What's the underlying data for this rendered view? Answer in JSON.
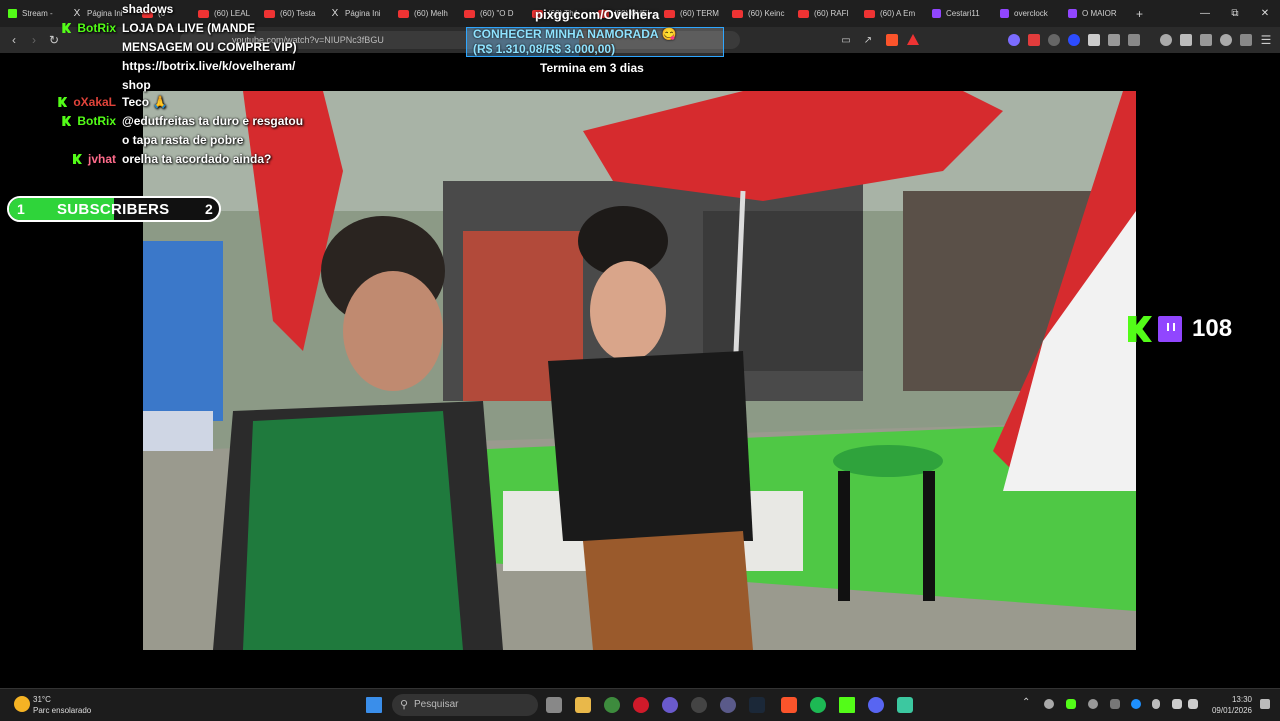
{
  "browser": {
    "tabs": [
      {
        "label": "Stream -",
        "icon": "kick-icon",
        "kind": "k"
      },
      {
        "label": "Página Ini",
        "icon": "x-icon",
        "kind": "x"
      },
      {
        "label": "(6",
        "icon": "youtube-icon",
        "kind": "yt"
      },
      {
        "label": "(60) LEAL",
        "icon": "youtube-icon",
        "kind": "yt"
      },
      {
        "label": "(60) Testa",
        "icon": "youtube-icon",
        "kind": "yt"
      },
      {
        "label": "Página Ini",
        "icon": "x-icon",
        "kind": "x"
      },
      {
        "label": "(60) Melh",
        "icon": "youtube-icon",
        "kind": "yt"
      },
      {
        "label": "(60) \"O D",
        "icon": "youtube-icon",
        "kind": "yt"
      },
      {
        "label": "(60) Thé",
        "icon": "youtube-icon",
        "kind": "yt"
      },
      {
        "label": "(60) CHEI",
        "icon": "youtube-icon",
        "kind": "yt"
      },
      {
        "label": "(60) TERM",
        "icon": "youtube-icon",
        "kind": "yt"
      },
      {
        "label": "(60) Keinc",
        "icon": "youtube-icon",
        "kind": "yt"
      },
      {
        "label": "(60) RAFI",
        "icon": "youtube-icon",
        "kind": "yt"
      },
      {
        "label": "(60) A Em",
        "icon": "youtube-icon",
        "kind": "yt"
      },
      {
        "label": "Cestari11",
        "icon": "twitch-icon",
        "kind": "tw"
      },
      {
        "label": "overclock",
        "icon": "twitch-icon",
        "kind": "tw"
      },
      {
        "label": "O MAIOR",
        "icon": "twitch-icon",
        "kind": "tw"
      }
    ],
    "new_tab": "+",
    "url": "youtube.com/watch?v=NIUPNc3fBGU"
  },
  "overlay": {
    "pix_title": "pixgg.com/Ovelhera",
    "goal_line1": "CONHECER MINHA NAMORADA 😋",
    "goal_line2": "(R$ 1.310,08/R$ 3.000,00)",
    "goal_progress": 0.4367,
    "ends_text": "Termina em 3 dias",
    "sub_goal": {
      "current": "1",
      "label": "SUBSCRIBERS",
      "target": "2",
      "progress": 0.5
    },
    "viewers": "108"
  },
  "chat": [
    {
      "user": "",
      "text": "shadows",
      "user_color": "#ffffff"
    },
    {
      "user": "BotRix",
      "text": "LOJA DA LIVE (MANDE",
      "user_color": "#53fc18"
    },
    {
      "user": "",
      "text": "MENSAGEM OU COMPRE VIP)",
      "user_color": "#ffffff"
    },
    {
      "user": "",
      "text": "https://botrix.live/k/ovelheram/",
      "user_color": "#ffffff"
    },
    {
      "user": "",
      "text": "shop",
      "user_color": "#ffffff"
    },
    {
      "user": "oXakaL",
      "text": "Teco 🙏",
      "user_color": "#e0433a"
    },
    {
      "user": "BotRix",
      "text": "@edutfreitas ta duro e resgatou",
      "user_color": "#53fc18"
    },
    {
      "user": "",
      "text": "o tapa rasta de pobre",
      "user_color": "#ffffff"
    },
    {
      "user": "jvhat",
      "text": "orelha ta acordado ainda?",
      "user_color": "#ff6b8b"
    }
  ],
  "taskbar": {
    "weather_temp": "31°C",
    "weather_desc": "Parc ensolarado",
    "search_placeholder": "Pesquisar",
    "time": "13:30",
    "date": "09/01/2026"
  }
}
